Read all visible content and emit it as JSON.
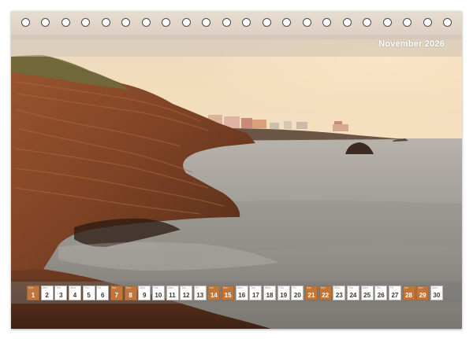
{
  "calendar": {
    "month_title": "November 2026",
    "ring_count": 22,
    "days": [
      {
        "dow": "Sun",
        "num": "1",
        "weekend": true
      },
      {
        "dow": "Mon",
        "num": "2",
        "weekend": false
      },
      {
        "dow": "Tue",
        "num": "3",
        "weekend": false
      },
      {
        "dow": "Wed",
        "num": "4",
        "weekend": false
      },
      {
        "dow": "Thu",
        "num": "5",
        "weekend": false
      },
      {
        "dow": "Fri",
        "num": "6",
        "weekend": false
      },
      {
        "dow": "Sat",
        "num": "7",
        "weekend": true
      },
      {
        "dow": "Sun",
        "num": "8",
        "weekend": true
      },
      {
        "dow": "Mon",
        "num": "9",
        "weekend": false
      },
      {
        "dow": "Tue",
        "num": "10",
        "weekend": false
      },
      {
        "dow": "Wed",
        "num": "11",
        "weekend": false
      },
      {
        "dow": "Thu",
        "num": "12",
        "weekend": false
      },
      {
        "dow": "Fri",
        "num": "13",
        "weekend": false
      },
      {
        "dow": "Sat",
        "num": "14",
        "weekend": true
      },
      {
        "dow": "Sun",
        "num": "15",
        "weekend": true
      },
      {
        "dow": "Mon",
        "num": "16",
        "weekend": false
      },
      {
        "dow": "Tue",
        "num": "17",
        "weekend": false
      },
      {
        "dow": "Wed",
        "num": "18",
        "weekend": false
      },
      {
        "dow": "Thu",
        "num": "19",
        "weekend": false
      },
      {
        "dow": "Fri",
        "num": "20",
        "weekend": false
      },
      {
        "dow": "Sat",
        "num": "21",
        "weekend": true
      },
      {
        "dow": "Sun",
        "num": "22",
        "weekend": true
      },
      {
        "dow": "Mon",
        "num": "23",
        "weekend": false
      },
      {
        "dow": "Tue",
        "num": "24",
        "weekend": false
      },
      {
        "dow": "Wed",
        "num": "25",
        "weekend": false
      },
      {
        "dow": "Thu",
        "num": "26",
        "weekend": false
      },
      {
        "dow": "Fri",
        "num": "27",
        "weekend": false
      },
      {
        "dow": "Sat",
        "num": "28",
        "weekend": true
      },
      {
        "dow": "Sun",
        "num": "29",
        "weekend": true
      },
      {
        "dow": "Mon",
        "num": "30",
        "weekend": false
      }
    ]
  },
  "colors": {
    "weekend": "#c0763a",
    "sky": "#f1d9b8",
    "rock": "#8a4a28",
    "sea": "#9c9893"
  }
}
